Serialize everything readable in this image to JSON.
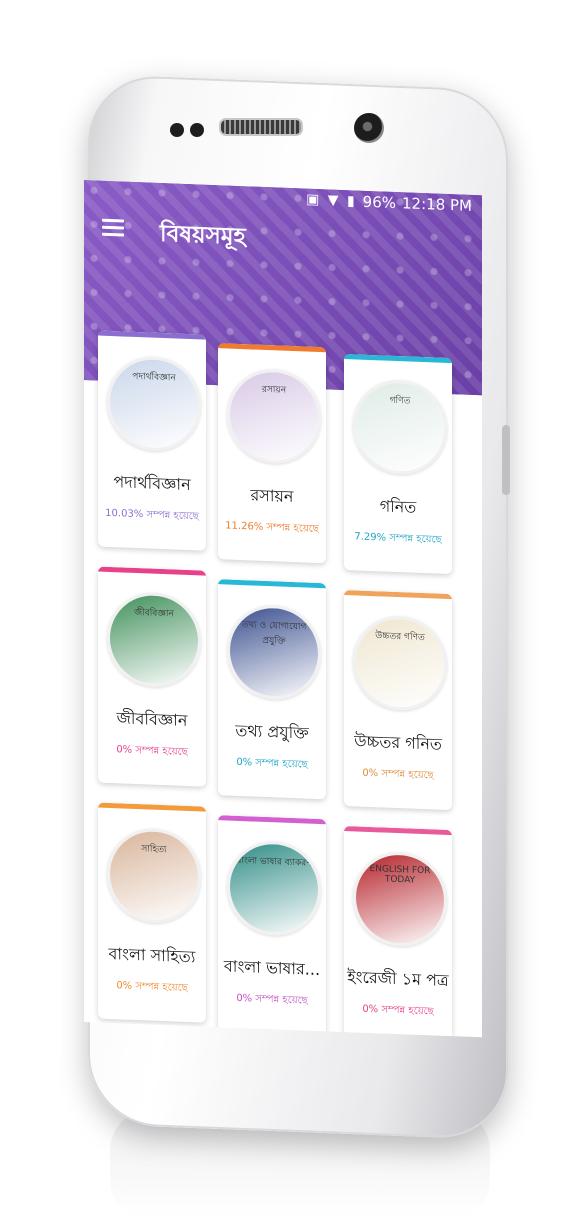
{
  "status": {
    "battery": "96%",
    "time": "12:18 PM"
  },
  "toolbar": {
    "title": "বিষয়সমূহ"
  },
  "subjects": [
    {
      "name": "পদার্থবিজ্ঞান",
      "progress": "10.03% সম্পন্ন হয়েছে",
      "accent": "#8b6fd0",
      "progress_color": "#8b6fd0",
      "cover_title": "পদার্থবিজ্ঞান",
      "cover_bg": "#c9d6ea"
    },
    {
      "name": "রসায়ন",
      "progress": "11.26% সম্পন্ন হয়েছে",
      "accent": "#f07b2e",
      "progress_color": "#f07b2e",
      "cover_title": "রসায়ন",
      "cover_bg": "#d8c9e6"
    },
    {
      "name": "গনিত",
      "progress": "7.29% সম্পন্ন হয়েছে",
      "accent": "#26b8d6",
      "progress_color": "#1fa7c4",
      "cover_title": "গণিত",
      "cover_bg": "#dfece6"
    },
    {
      "name": "জীববিজ্ঞান",
      "progress": "0% সম্পন্ন হয়েছে",
      "accent": "#e8418a",
      "progress_color": "#e8418a",
      "cover_title": "জীববিজ্ঞান",
      "cover_bg": "#3f8f5a"
    },
    {
      "name": "তথ্য প্রযুক্তি",
      "progress": "0% সম্পন্ন হয়েছে",
      "accent": "#26b8d6",
      "progress_color": "#1fa7c4",
      "cover_title": "তথ্য ও যোগাযোগ প্রযুক্তি",
      "cover_bg": "#3a4f8f"
    },
    {
      "name": "উচ্চতর গনিত",
      "progress": "0% সম্পন্ন হয়েছে",
      "accent": "#f0a35c",
      "progress_color": "#e08a3a",
      "cover_title": "উচ্চতর গণিত",
      "cover_bg": "#efe6cf"
    },
    {
      "name": "বাংলা সাহিত্য",
      "progress": "0% সম্পন্ন হয়েছে",
      "accent": "#f39a3a",
      "progress_color": "#f08a2a",
      "cover_title": "সাহিত্য",
      "cover_bg": "#d8b49a"
    },
    {
      "name": "বাংলা ভাষার...",
      "progress": "0% সম্পন্ন হয়েছে",
      "accent": "#d45fd0",
      "progress_color": "#c74fc4",
      "cover_title": "বাংলা ভাষার ব্যাকরণ",
      "cover_bg": "#2f8c86"
    },
    {
      "name": "ইংরেজী ১ম পত্র",
      "progress": "0% সম্পন্ন হয়েছে",
      "accent": "#e85a9a",
      "progress_color": "#e8418a",
      "cover_title": "ENGLISH FOR TODAY",
      "cover_bg": "#b5222a"
    }
  ]
}
